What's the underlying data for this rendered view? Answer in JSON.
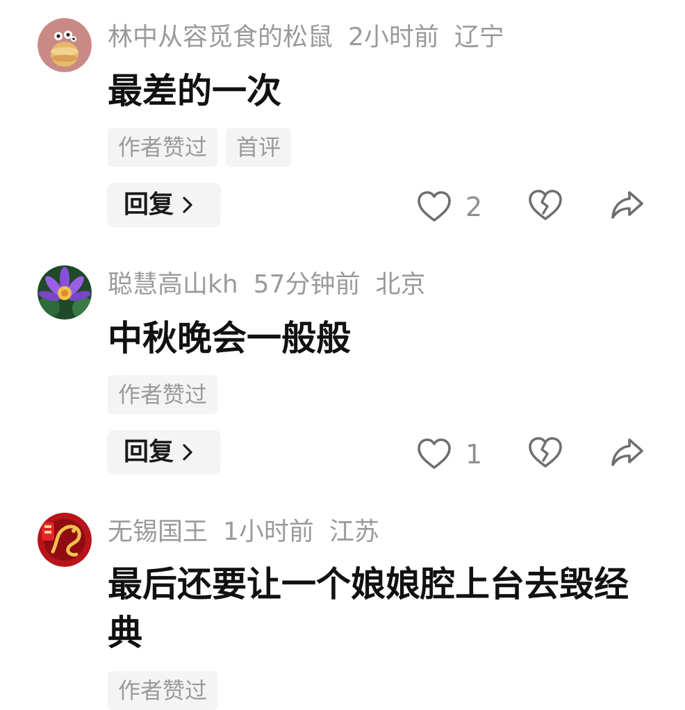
{
  "comments": [
    {
      "avatar_icon": "cartoon-avatar-icon",
      "username": "林中从容觅食的松鼠",
      "time": "2小时前",
      "location": "辽宁",
      "text": "最差的一次",
      "tags": [
        "作者赞过",
        "首评"
      ],
      "reply_label": "回复",
      "likes": "2"
    },
    {
      "avatar_icon": "lotus-flower-avatar-icon",
      "username": "聪慧高山kh",
      "time": "57分钟前",
      "location": "北京",
      "text": "中秋晚会一般般",
      "tags": [
        "作者赞过"
      ],
      "reply_label": "回复",
      "likes": "1"
    },
    {
      "avatar_icon": "dragon-avatar-icon",
      "username": "无锡国王",
      "time": "1小时前",
      "location": "江苏",
      "text": "最后还要让一个娘娘腔上台去毁经典",
      "tags": [
        "作者赞过"
      ]
    }
  ],
  "colors": {
    "meta_text": "#9a9a9a",
    "tag_bg": "#f4f4f5",
    "icon_stroke": "#6e6e6e"
  },
  "icons": {
    "like": "heart-outline-icon",
    "dislike": "broken-heart-icon",
    "share": "share-arrow-icon",
    "reply_chevron": "chevron-right-icon"
  }
}
